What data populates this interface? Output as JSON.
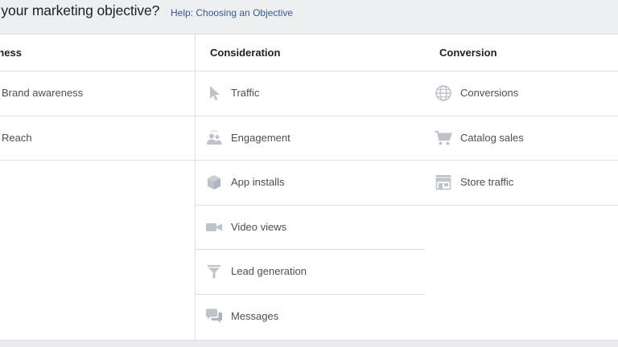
{
  "header": {
    "question": "s your marketing objective?",
    "help_link": "Help: Choosing an Objective"
  },
  "columns": {
    "awareness": {
      "title": "reness",
      "items": [
        {
          "label": "Brand awareness"
        },
        {
          "label": "Reach"
        }
      ]
    },
    "consideration": {
      "title": "Consideration",
      "items": [
        {
          "label": "Traffic",
          "icon": "cursor-icon"
        },
        {
          "label": "Engagement",
          "icon": "people-icon"
        },
        {
          "label": "App installs",
          "icon": "box-icon"
        },
        {
          "label": "Video views",
          "icon": "video-camera-icon"
        },
        {
          "label": "Lead generation",
          "icon": "funnel-icon"
        },
        {
          "label": "Messages",
          "icon": "chat-bubbles-icon"
        }
      ]
    },
    "conversion": {
      "title": "Conversion",
      "items": [
        {
          "label": "Conversions",
          "icon": "globe-icon"
        },
        {
          "label": "Catalog sales",
          "icon": "shopping-cart-icon"
        },
        {
          "label": "Store traffic",
          "icon": "storefront-icon"
        }
      ]
    }
  },
  "colors": {
    "icon": "#bec3c9",
    "text": "#4b4f56",
    "link": "#385898",
    "border": "#dddfe2"
  }
}
